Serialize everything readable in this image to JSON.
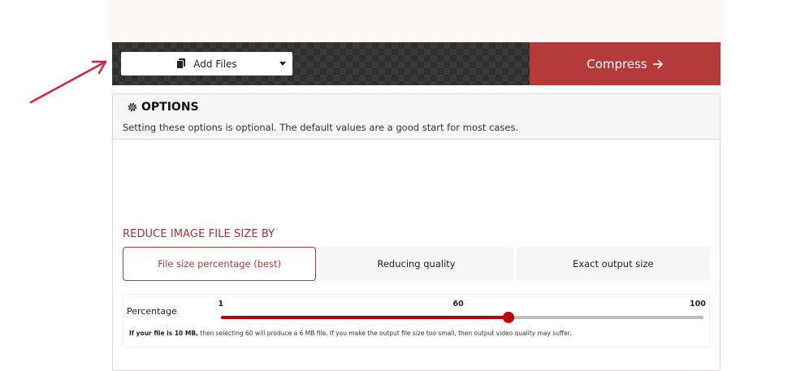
{
  "toolbar": {
    "add_files_label": "Add Files",
    "compress_label": "Compress",
    "compress_color": "#b53a3a"
  },
  "options": {
    "title": "OPTIONS",
    "description": "Setting these options is optional. The default values are a good start for most cases."
  },
  "reduce": {
    "title": "REDUCE IMAGE FILE SIZE BY",
    "tabs": [
      {
        "label": "File size percentage (best)",
        "active": true
      },
      {
        "label": "Reducing quality",
        "active": false
      },
      {
        "label": "Exact output size",
        "active": false
      }
    ],
    "accent_color": "#b53a3a"
  },
  "slider": {
    "label": "Percentage",
    "min": 1,
    "max": 100,
    "value": 60,
    "min_label": "1",
    "mid_label": "60",
    "max_label": "100",
    "help_bold": "If your file is 10 MB,",
    "help_text": " then selecting 60 will produce a 6 MB file. If you make the output file size too small, then output video quality may suffer."
  },
  "icons": {
    "add_files": "file-icon",
    "add_files_menu": "chevron-down-icon",
    "compress": "arrow-right-icon",
    "options": "gear-icon",
    "annotation": "arrow-icon"
  },
  "annotation_color": "#d6223a"
}
